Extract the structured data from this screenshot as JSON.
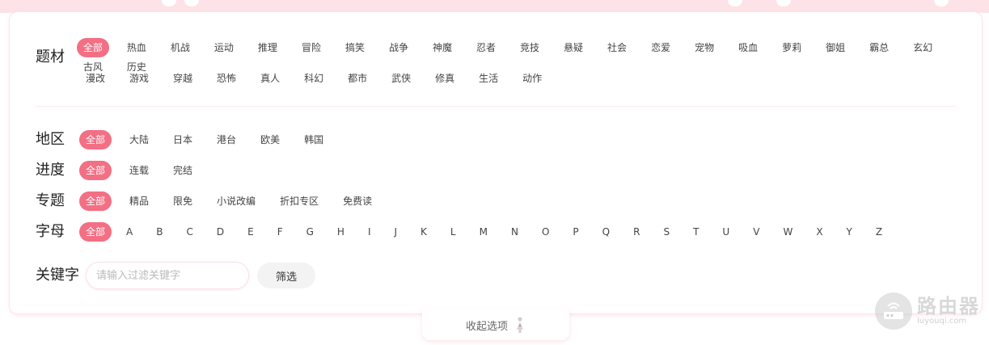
{
  "filters": {
    "theme": {
      "label": "题材",
      "items": [
        "全部",
        "热血",
        "机战",
        "运动",
        "推理",
        "冒险",
        "搞笑",
        "战争",
        "神魔",
        "忍者",
        "竞技",
        "悬疑",
        "社会",
        "恋爱",
        "宠物",
        "吸血",
        "萝莉",
        "御姐",
        "霸总",
        "玄幻",
        "古风",
        "历史"
      ],
      "items_row2": [
        "漫改",
        "游戏",
        "穿越",
        "恐怖",
        "真人",
        "科幻",
        "都市",
        "武侠",
        "修真",
        "生活",
        "动作"
      ]
    },
    "region": {
      "label": "地区",
      "items": [
        "全部",
        "大陆",
        "日本",
        "港台",
        "欧美",
        "韩国"
      ]
    },
    "progress": {
      "label": "进度",
      "items": [
        "全部",
        "连载",
        "完结"
      ]
    },
    "topic": {
      "label": "专题",
      "items": [
        "全部",
        "精品",
        "限免",
        "小说改编",
        "折扣专区",
        "免费读"
      ]
    },
    "letter": {
      "label": "字母",
      "items": [
        "全部",
        "A",
        "B",
        "C",
        "D",
        "E",
        "F",
        "G",
        "H",
        "I",
        "J",
        "K",
        "L",
        "M",
        "N",
        "O",
        "P",
        "Q",
        "R",
        "S",
        "T",
        "U",
        "V",
        "W",
        "X",
        "Y",
        "Z"
      ]
    }
  },
  "keyword": {
    "label": "关键字",
    "placeholder": "请输入过滤关键字",
    "value": "",
    "button": "筛选"
  },
  "collapse": {
    "label": "收起选项"
  },
  "watermark": {
    "cn": "路由器",
    "en": "luyouqi.com"
  },
  "colors": {
    "accent": "#f36f84",
    "border": "#fbe0e6",
    "strip": "#fde3e8"
  }
}
